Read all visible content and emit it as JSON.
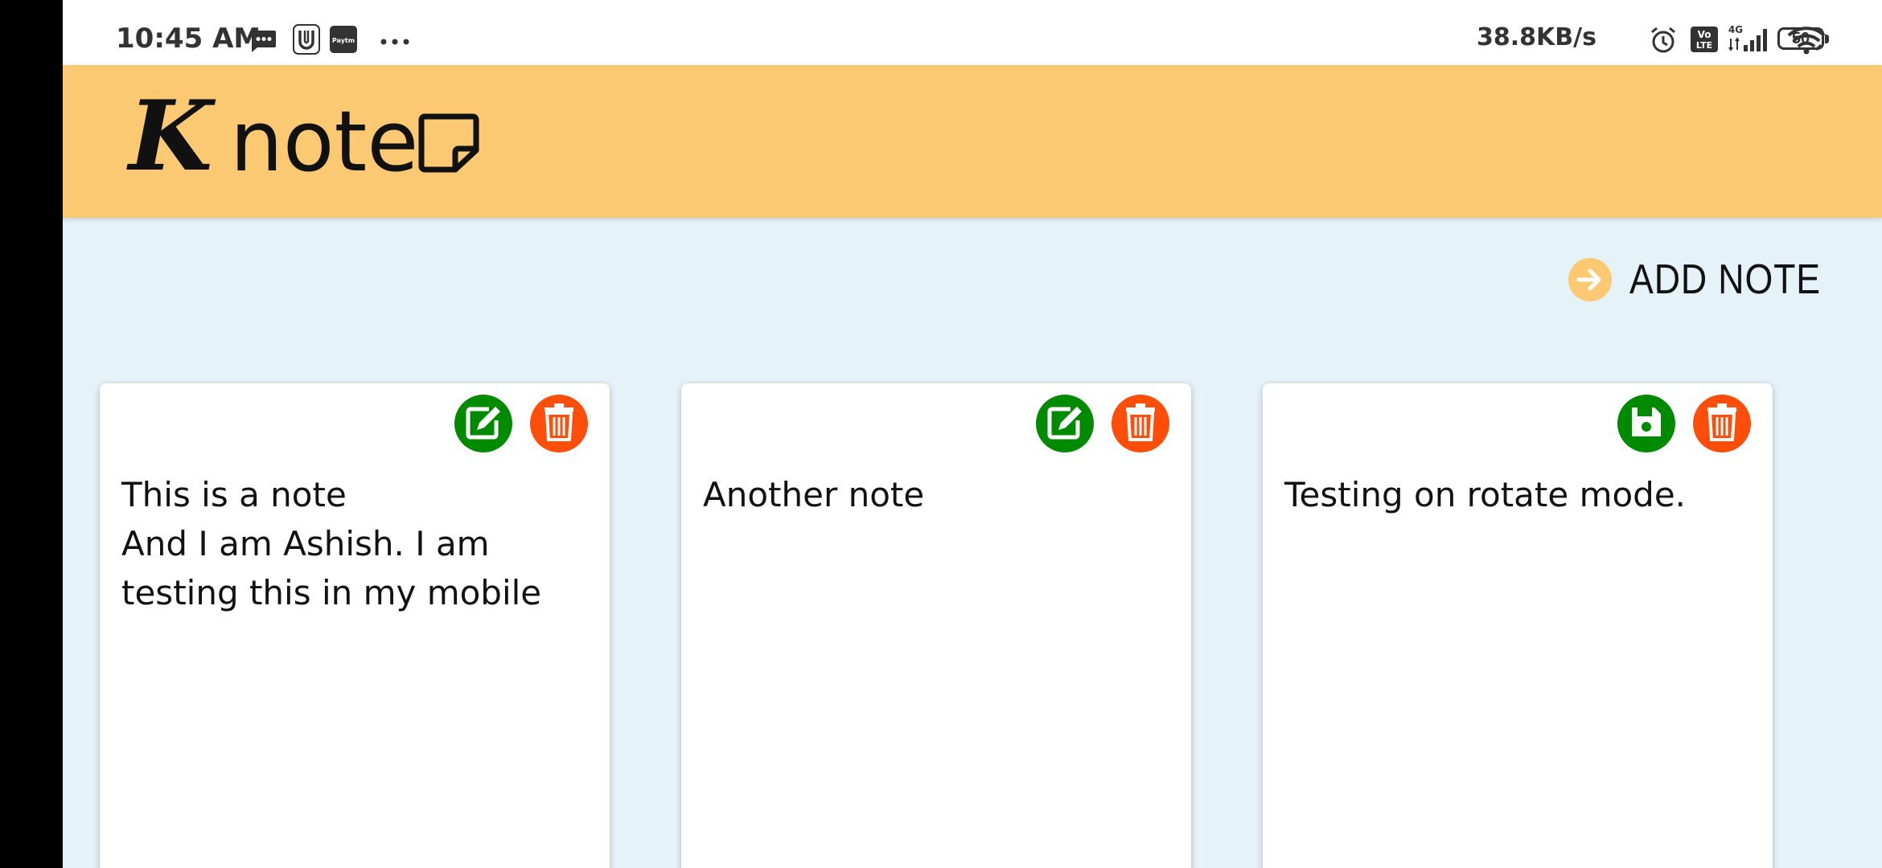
{
  "status_bar": {
    "time": "10:45 AM",
    "network_speed": "38.8KB/s",
    "battery_level": "50",
    "icons": [
      "message-icon",
      "upi-icon",
      "paytm-icon",
      "more-dots-icon",
      "alarm-icon",
      "volte-icon",
      "signal-4g-icon",
      "wifi-icon",
      "battery-icon"
    ],
    "paytm_label": "Paytm",
    "volte_label": "Vo LTE",
    "network_type": "4G"
  },
  "header": {
    "logo_letter": "K",
    "logo_text": "note",
    "logo_icon": "sticky-note-icon",
    "background": "#fbc971"
  },
  "actions": {
    "add_note_label": "ADD NOTE",
    "add_note_icon": "arrow-right-circle-icon"
  },
  "notes": [
    {
      "content": "This is a note\nAnd I am Ashish. I am testing this in my mobile",
      "primary_action": "edit",
      "primary_icon": "edit-icon",
      "delete_icon": "trash-icon"
    },
    {
      "content": "Another note",
      "primary_action": "edit",
      "primary_icon": "edit-icon",
      "delete_icon": "trash-icon"
    },
    {
      "content": "Testing on rotate mode.",
      "primary_action": "save",
      "primary_icon": "save-icon",
      "delete_icon": "trash-icon"
    }
  ],
  "colors": {
    "page_background": "#e5f2f8",
    "edit_button": "#008a00",
    "delete_button": "#ff4d0a",
    "accent": "#fbc971"
  }
}
